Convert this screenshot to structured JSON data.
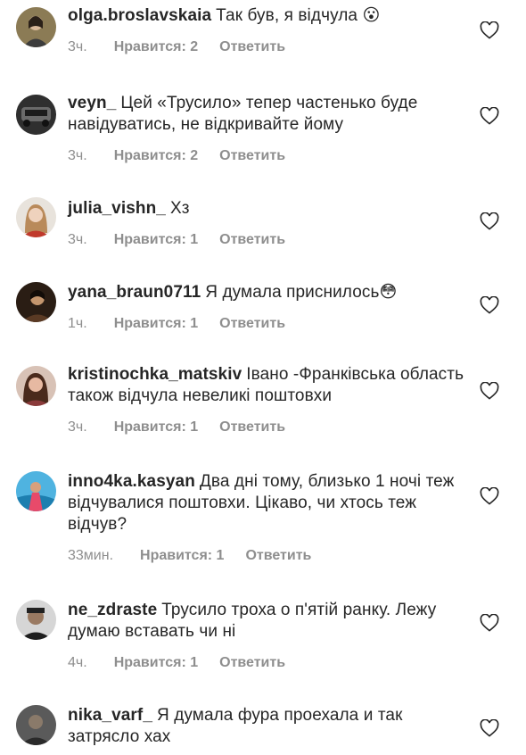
{
  "comments": [
    {
      "username": "olga.broslavskaia",
      "text": "Так був, я відчула 😮",
      "time": "3ч.",
      "likes": "Нравится: 2",
      "reply": "Ответить",
      "avatar_color": "#7a6a4a",
      "heart_icon": "heart-outline"
    },
    {
      "username": "veyn_",
      "text": "Цей «Трусило» тепер частенько буде навідуватись, не відкривайте йому",
      "time": "3ч.",
      "likes": "Нравится: 2",
      "reply": "Ответить",
      "avatar_color": "#4a4a4a",
      "heart_icon": "heart-outline"
    },
    {
      "username": "julia_vishn_",
      "text": "Хз",
      "time": "3ч.",
      "likes": "Нравится: 1",
      "reply": "Ответить",
      "avatar_color": "#c0392b",
      "heart_icon": "heart-outline"
    },
    {
      "username": "yana_braun0711",
      "text": "Я думала приснилось😳",
      "time": "1ч.",
      "likes": "Нравится: 1",
      "reply": "Ответить",
      "avatar_color": "#3b2a1e",
      "heart_icon": "heart-outline"
    },
    {
      "username": "kristinochka_matskiv",
      "text": "Івано -Франківська область  також відчула невеликі поштовхи",
      "time": "3ч.",
      "likes": "Нравится: 1",
      "reply": "Ответить",
      "avatar_color": "#a05a4a",
      "heart_icon": "heart-outline"
    },
    {
      "username": "inno4ka.kasyan",
      "text": "Два дні тому, близько 1 ночі теж відчувалися поштовхи. Цікаво, чи хтось теж відчув?",
      "time": "33мин.",
      "likes": "Нравится: 1",
      "reply": "Ответить",
      "avatar_color": "#2a8fc0",
      "heart_icon": "heart-outline"
    },
    {
      "username": "ne_zdraste",
      "text": "Трусило троха о п'ятій ранку. Лежу думаю вставать чи ні",
      "time": "4ч.",
      "likes": "Нравится: 1",
      "reply": "Ответить",
      "avatar_color": "#5a5a5a",
      "heart_icon": "heart-outline"
    },
    {
      "username": "nika_varf_",
      "text": "Я думала фура проехала и так затрясло хах",
      "time": "",
      "likes": "",
      "reply": "",
      "avatar_color": "#444444",
      "heart_icon": "heart-outline"
    }
  ]
}
